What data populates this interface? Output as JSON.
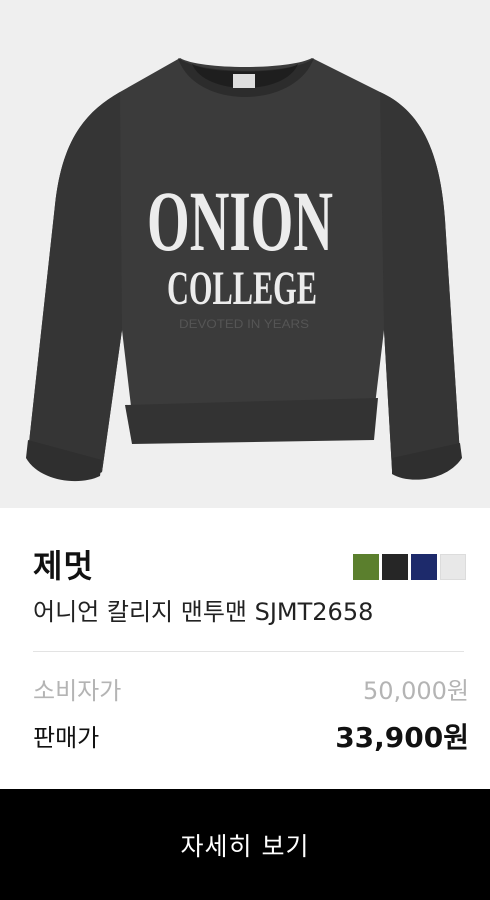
{
  "product": {
    "image": {
      "print_line1": "ONION",
      "print_line2": "COLLEGE",
      "print_line3": "DEVOTED IN YEARS"
    },
    "brand": "제멋",
    "name": "어니언 칼리지 맨투맨 SJMT2658",
    "color_swatches": [
      {
        "color": "#5b7f2d"
      },
      {
        "color": "#262626"
      },
      {
        "color": "#1d2a6b"
      },
      {
        "color": "#e8e8e8"
      }
    ],
    "prices": {
      "retail_label": "소비자가",
      "retail_value": "50,000원",
      "sale_label": "판매가",
      "sale_value": "33,900원"
    },
    "detail_button_label": "자세히 보기"
  },
  "colors": {
    "garment": "#3b3b3b",
    "background": "#efefef",
    "button": "#000000"
  }
}
